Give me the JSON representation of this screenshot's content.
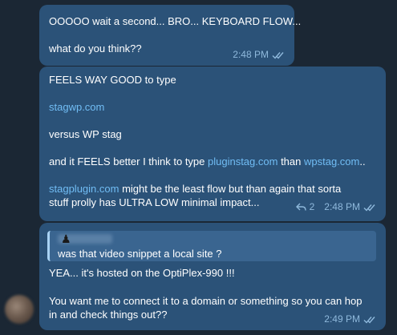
{
  "messages": [
    {
      "lines": [
        "OOOOO wait a second... BRO... KEYBOARD FLOW...",
        "what do you think??"
      ],
      "time": "2:48 PM"
    },
    {
      "line1": "FEELS WAY GOOD to type",
      "line2_link": "stagwp.com",
      "line3": "versus WP stag",
      "line4_pre": "and it FEELS better I think to type ",
      "line4_link1": "pluginstag.com",
      "line4_mid": " than ",
      "line4_link2": "wpstag.com",
      "line4_post": "..",
      "line5_link": "stagplugin.com",
      "line5_text": " might be the least flow but than again that sorta",
      "line6": "stuff prolly has ULTRA LOW minimal impact...",
      "reply_count": "2",
      "time": "2:48 PM"
    },
    {
      "quote_text": "was that video snippet a local site ?",
      "quote_icon": "chess-pawn-icon",
      "line1": "YEA... it's hosted on the OptiPlex-990 !!!",
      "line2": "You want me to connect it to a domain or something so you can hop",
      "line3": "in and check things out??",
      "time": "2:49 PM"
    }
  ],
  "colors": {
    "background": "#1b2734",
    "bubble": "#2b5278",
    "link": "#71bdf5",
    "meta": "#8fb9dc",
    "quote_bar": "#a9d3f4"
  }
}
